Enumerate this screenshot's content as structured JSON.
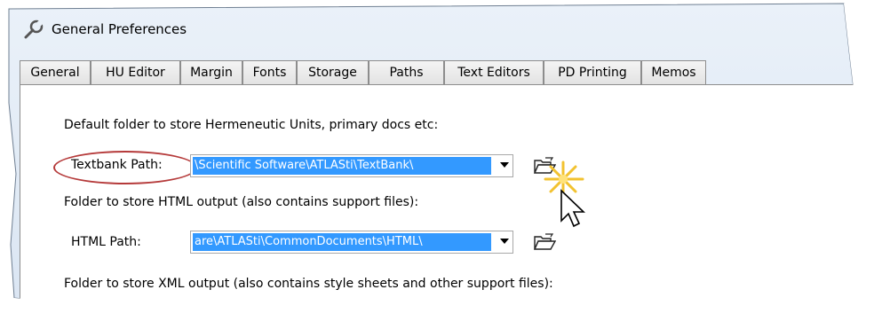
{
  "window": {
    "title": "General Preferences",
    "icon": "wrench-icon"
  },
  "tabs": [
    {
      "label": "General",
      "active": false
    },
    {
      "label": "HU Editor",
      "active": false
    },
    {
      "label": "Margin",
      "active": false
    },
    {
      "label": "Fonts",
      "active": false
    },
    {
      "label": "Storage",
      "active": false
    },
    {
      "label": "Paths",
      "active": true
    },
    {
      "label": "Text Editors",
      "active": false
    },
    {
      "label": "PD Printing",
      "active": false
    },
    {
      "label": "Memos",
      "active": false
    }
  ],
  "paths": {
    "textbank": {
      "description": "Default folder to store Hermeneutic Units, primary docs etc:",
      "label": "Textbank Path:",
      "value": "\\Scientific Software\\ATLASti\\TextBank\\"
    },
    "html": {
      "description": "Folder to store HTML output (also contains support files):",
      "label": "HTML Path:",
      "value": "are\\ATLASti\\CommonDocuments\\HTML\\"
    },
    "xml": {
      "description": "Folder to store XML output (also contains style sheets and other support files):"
    }
  },
  "colors": {
    "selection": "#3399ff",
    "highlight_oval": "#b53a3a"
  }
}
